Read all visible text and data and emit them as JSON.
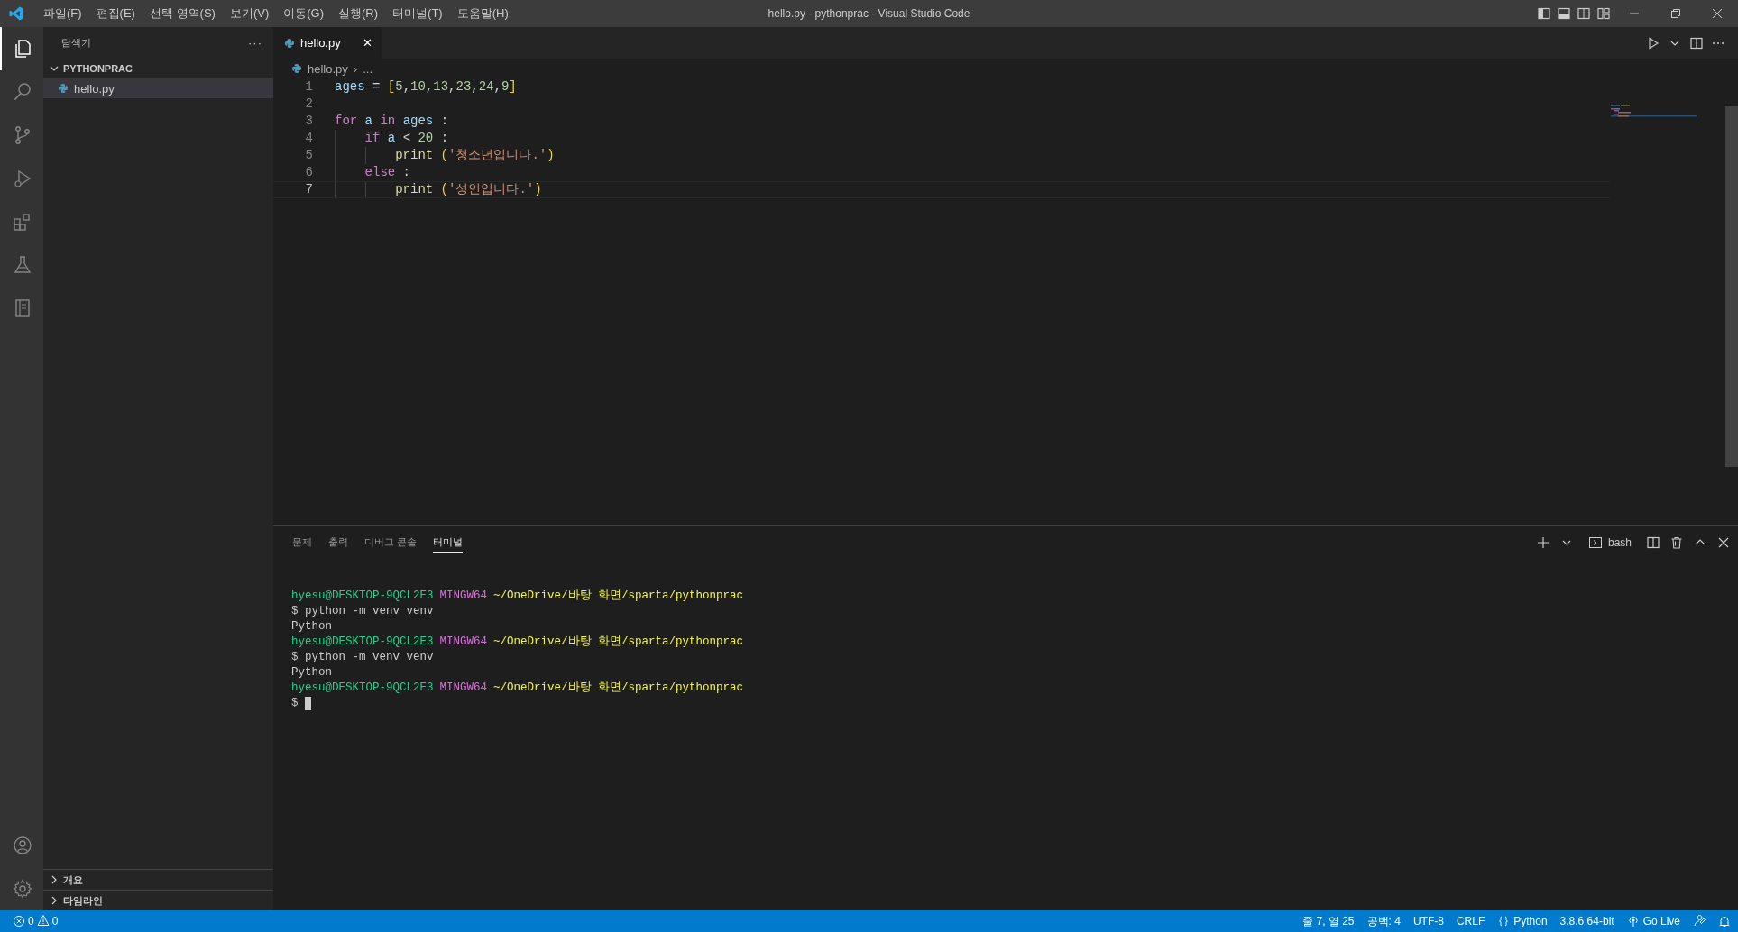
{
  "window": {
    "title": "hello.py - pythonprac - Visual Studio Code"
  },
  "menu": [
    "파일(F)",
    "편집(E)",
    "선택 영역(S)",
    "보기(V)",
    "이동(G)",
    "실행(R)",
    "터미널(T)",
    "도움말(H)"
  ],
  "activity_bar": [
    {
      "kind": "files",
      "selected": true
    },
    {
      "kind": "search",
      "selected": false
    },
    {
      "kind": "branch",
      "selected": false
    },
    {
      "kind": "run",
      "selected": false
    },
    {
      "kind": "extensions",
      "selected": false
    },
    {
      "kind": "flask",
      "selected": false
    },
    {
      "kind": "notebook",
      "selected": false
    }
  ],
  "sidebar": {
    "title": "탐색기",
    "more": "···",
    "folder": {
      "name": "PYTHONPRAC",
      "expanded": true,
      "children": [
        {
          "name": "hello.py",
          "selected": true
        }
      ]
    },
    "sections": [
      {
        "name": "개요",
        "expanded": false
      },
      {
        "name": "타임라인",
        "expanded": false
      }
    ]
  },
  "tabs": [
    {
      "label": "hello.py",
      "selected": true,
      "close": "✕"
    }
  ],
  "breadcrumb": {
    "file": "hello.py",
    "separator": "›",
    "rest": "..."
  },
  "editor": {
    "lines": [
      {
        "number": "1",
        "current": false,
        "tokens": [
          {
            "kind": "var",
            "text": "ages"
          },
          {
            "kind": "op",
            "text": " ="
          },
          {
            "kind": "bracket",
            "text": " ["
          },
          {
            "kind": "num",
            "text": "5"
          },
          {
            "kind": "op",
            "text": ","
          },
          {
            "kind": "num",
            "text": "10"
          },
          {
            "kind": "op",
            "text": ","
          },
          {
            "kind": "num",
            "text": "13"
          },
          {
            "kind": "op",
            "text": ","
          },
          {
            "kind": "num",
            "text": "23"
          },
          {
            "kind": "op",
            "text": ","
          },
          {
            "kind": "num",
            "text": "24"
          },
          {
            "kind": "op",
            "text": ","
          },
          {
            "kind": "num",
            "text": "9"
          },
          {
            "kind": "bracket",
            "text": "]"
          }
        ]
      },
      {
        "number": "2",
        "current": false
      },
      {
        "number": "3",
        "current": false,
        "tokens": [
          {
            "kind": "keyword",
            "text": "for"
          },
          {
            "kind": "var",
            "text": " a"
          },
          {
            "kind": "keyword",
            "text": " in"
          },
          {
            "kind": "var",
            "text": " ages"
          },
          {
            "kind": "op",
            "text": " :"
          }
        ]
      },
      {
        "number": "4",
        "current": false,
        "tokens": [
          {
            "kind": "keyword",
            "text": "    if"
          },
          {
            "kind": "var",
            "text": " a"
          },
          {
            "kind": "op",
            "text": " <"
          },
          {
            "kind": "num",
            "text": " 20"
          },
          {
            "kind": "op",
            "text": " :"
          }
        ]
      },
      {
        "number": "5",
        "current": false,
        "tokens": [
          {
            "kind": "func",
            "text": "        print"
          },
          {
            "kind": "bracket",
            "text": " ("
          },
          {
            "kind": "str",
            "text": "'청소년입니다.'"
          },
          {
            "kind": "bracket",
            "text": ")"
          }
        ]
      },
      {
        "number": "6",
        "current": false,
        "tokens": [
          {
            "kind": "keyword",
            "text": "    else"
          },
          {
            "kind": "op",
            "text": " :"
          }
        ]
      },
      {
        "number": "7",
        "current": true,
        "tokens": [
          {
            "kind": "func",
            "text": "        print"
          },
          {
            "kind": "bracket",
            "text": " ("
          },
          {
            "kind": "str",
            "text": "'성인입니다.'"
          },
          {
            "kind": "bracket",
            "text": ")"
          }
        ]
      }
    ]
  },
  "panel": {
    "tabs": [
      {
        "label": "문제",
        "selected": false
      },
      {
        "label": "출력",
        "selected": false
      },
      {
        "label": "디버그 콘솔",
        "selected": false
      },
      {
        "label": "터미널",
        "selected": true
      }
    ],
    "shell": "bash",
    "terminal": [
      [
        {
          "kind": "user",
          "text": "hyesu@DESKTOP-9QCL2E3"
        },
        {
          "kind": "host",
          "text": "MINGW64"
        },
        {
          "kind": "path",
          "text": "~/OneDrive/바탕 화면/sparta/pythonprac"
        }
      ],
      [
        {
          "kind": "plain",
          "text": "$ python -m venv venv"
        }
      ],
      [
        {
          "kind": "plain",
          "text": "Python"
        }
      ],
      [
        {
          "kind": "user",
          "text": "hyesu@DESKTOP-9QCL2E3"
        },
        {
          "kind": "host",
          "text": "MINGW64"
        },
        {
          "kind": "path",
          "text": "~/OneDrive/바탕 화면/sparta/pythonprac"
        }
      ],
      [
        {
          "kind": "plain",
          "text": "$ python -m venv venv"
        }
      ],
      [
        {
          "kind": "plain",
          "text": "Python"
        }
      ],
      [
        {
          "kind": "user",
          "text": "hyesu@DESKTOP-9QCL2E3"
        },
        {
          "kind": "host",
          "text": "MINGW64"
        },
        {
          "kind": "path",
          "text": "~/OneDrive/바탕 화면/sparta/pythonprac"
        }
      ],
      [
        {
          "kind": "plain",
          "text": "$"
        },
        {
          "kind": "cursor"
        }
      ]
    ]
  },
  "status_bar": {
    "errors": "0",
    "warnings": "0",
    "right": [
      {
        "kind": "text",
        "text": "줄 7, 열 25"
      },
      {
        "kind": "text",
        "text": "공백: 4"
      },
      {
        "kind": "text",
        "text": "UTF-8"
      },
      {
        "kind": "text",
        "text": "CRLF"
      },
      {
        "kind": "language",
        "text": "Python"
      },
      {
        "kind": "text",
        "text": "3.8.6 64-bit"
      },
      {
        "kind": "live",
        "text": "Go Live"
      },
      {
        "kind": "feedback"
      },
      {
        "kind": "bell"
      }
    ]
  }
}
